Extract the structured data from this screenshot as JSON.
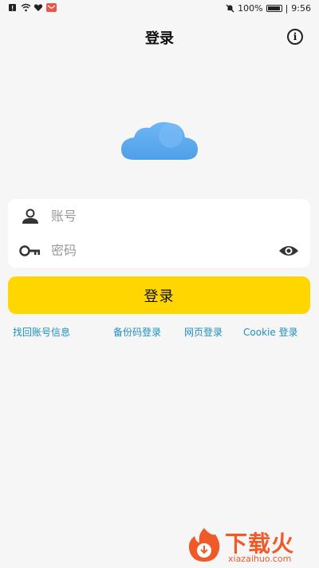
{
  "status_bar": {
    "battery_percent": "100%",
    "time": "9:56"
  },
  "header": {
    "title": "登录",
    "info_icon": "info-circle-icon"
  },
  "form": {
    "account_placeholder": "账号",
    "account_value": "",
    "password_placeholder": "密码",
    "password_value": "",
    "account_icon": "user-icon",
    "password_icon": "key-icon",
    "visibility_icon": "eye-icon"
  },
  "login_button": {
    "label": "登录"
  },
  "links": {
    "recover": "找回账号信息",
    "backup_code": "备份码登录",
    "web": "网页登录",
    "cookie": "Cookie 登录"
  },
  "watermark": {
    "brand": "下载火",
    "url": "xiazaihuo.com"
  },
  "colors": {
    "accent_yellow": "#ffd600",
    "link_blue": "#1f8fc1",
    "cloud_blue": "#5aa8f0",
    "watermark_orange": "#f05a28",
    "background": "#f6f6f6"
  }
}
